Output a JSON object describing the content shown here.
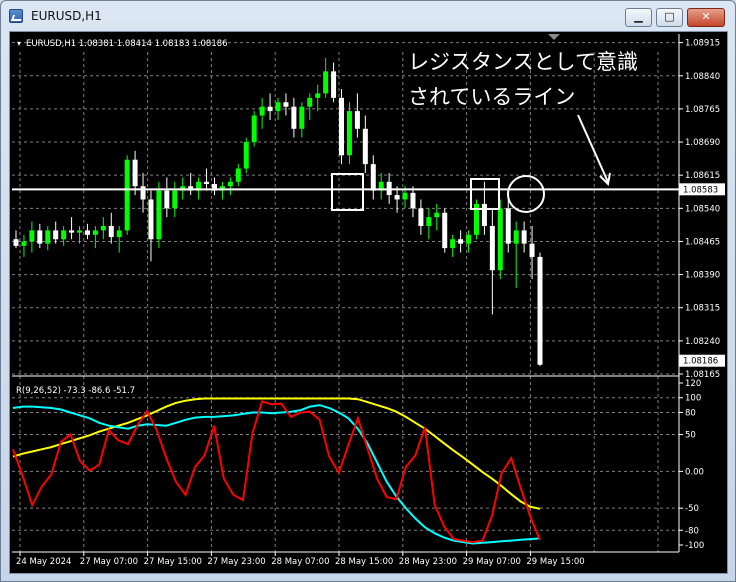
{
  "window": {
    "title": "EURUSD,H1",
    "buttons": {
      "minimize": "▁",
      "maximize": "□",
      "close": "✕"
    }
  },
  "chart_data": [
    {
      "type": "candlestick",
      "title": "EURUSD,H1",
      "header": "EURUSD,H1  1.08381 1.08414 1.08183 1.08186",
      "ylim": [
        1.08165,
        1.0893
      ],
      "y_ticks": [
        "1.08915",
        "1.08840",
        "1.08765",
        "1.08690",
        "1.08615",
        "1.08540",
        "1.08465",
        "1.08390",
        "1.08315",
        "1.08240",
        "1.08165"
      ],
      "x_ticks": [
        "24 May 2024",
        "27 May 07:00",
        "27 May 15:00",
        "27 May 23:00",
        "28 May 07:00",
        "28 May 15:00",
        "28 May 23:00",
        "29 May 07:00",
        "29 May 15:00"
      ],
      "last_price": "1.08186",
      "resistance_price": "1.08583",
      "resistance_value": 1.08583,
      "colors": {
        "bull": "#00ff00",
        "bear": "#ffffff",
        "grid": "#7f7f7f",
        "line": "#ffffff"
      },
      "annotation": {
        "text_line1": "レジスタンスとして意識",
        "text_line2": "されているライン"
      },
      "candles": [
        [
          1.0847,
          1.0849,
          1.0845,
          1.08455
        ],
        [
          1.08455,
          1.0848,
          1.0843,
          1.08465
        ],
        [
          1.08465,
          1.0851,
          1.0844,
          1.0849
        ],
        [
          1.0849,
          1.08505,
          1.0845,
          1.0846
        ],
        [
          1.0846,
          1.085,
          1.08445,
          1.0849
        ],
        [
          1.0849,
          1.0851,
          1.0846,
          1.0847
        ],
        [
          1.0847,
          1.085,
          1.08455,
          1.0849
        ],
        [
          1.0849,
          1.0852,
          1.0847,
          1.08485
        ],
        [
          1.08485,
          1.085,
          1.0846,
          1.0849
        ],
        [
          1.0849,
          1.08505,
          1.0847,
          1.0848
        ],
        [
          1.0848,
          1.085,
          1.0845,
          1.0849
        ],
        [
          1.0849,
          1.0852,
          1.0847,
          1.085
        ],
        [
          1.085,
          1.0853,
          1.0846,
          1.08475
        ],
        [
          1.08475,
          1.085,
          1.0844,
          1.0849
        ],
        [
          1.0849,
          1.0866,
          1.0848,
          1.0865
        ],
        [
          1.0865,
          1.0867,
          1.0857,
          1.0859
        ],
        [
          1.0859,
          1.0862,
          1.0853,
          1.0856
        ],
        [
          1.0856,
          1.0858,
          1.0842,
          1.0847
        ],
        [
          1.0847,
          1.086,
          1.0845,
          1.0858
        ],
        [
          1.0858,
          1.0861,
          1.0852,
          1.0854
        ],
        [
          1.0854,
          1.086,
          1.0852,
          1.0858
        ],
        [
          1.0858,
          1.0861,
          1.0856,
          1.0859
        ],
        [
          1.0859,
          1.0862,
          1.0857,
          1.0858
        ],
        [
          1.0858,
          1.0861,
          1.0856,
          1.086
        ],
        [
          1.086,
          1.0863,
          1.0858,
          1.08595
        ],
        [
          1.08595,
          1.0861,
          1.0857,
          1.0858
        ],
        [
          1.0858,
          1.086,
          1.0856,
          1.0859
        ],
        [
          1.0859,
          1.0861,
          1.0857,
          1.086
        ],
        [
          1.086,
          1.0864,
          1.0859,
          1.0863
        ],
        [
          1.0863,
          1.087,
          1.0862,
          1.0869
        ],
        [
          1.0869,
          1.0876,
          1.0868,
          1.0875
        ],
        [
          1.0875,
          1.0879,
          1.0872,
          1.0877
        ],
        [
          1.0877,
          1.088,
          1.0874,
          1.0876
        ],
        [
          1.0876,
          1.0879,
          1.0874,
          1.0878
        ],
        [
          1.0878,
          1.088,
          1.0875,
          1.0877
        ],
        [
          1.0877,
          1.0879,
          1.087,
          1.0872
        ],
        [
          1.0872,
          1.0878,
          1.087,
          1.0877
        ],
        [
          1.0877,
          1.088,
          1.0874,
          1.0879
        ],
        [
          1.0879,
          1.0882,
          1.0876,
          1.088
        ],
        [
          1.088,
          1.0888,
          1.0879,
          1.0885
        ],
        [
          1.0885,
          1.0887,
          1.0878,
          1.0879
        ],
        [
          1.0879,
          1.0881,
          1.0864,
          1.0866
        ],
        [
          1.0866,
          1.0878,
          1.0864,
          1.0876
        ],
        [
          1.0876,
          1.088,
          1.087,
          1.0872
        ],
        [
          1.0872,
          1.0875,
          1.0862,
          1.0864
        ],
        [
          1.0864,
          1.0866,
          1.0856,
          1.0858
        ],
        [
          1.0858,
          1.0862,
          1.0856,
          1.086
        ],
        [
          1.086,
          1.0862,
          1.0855,
          1.0857
        ],
        [
          1.0857,
          1.0859,
          1.0853,
          1.0856
        ],
        [
          1.0856,
          1.0859,
          1.0854,
          1.08575
        ],
        [
          1.08575,
          1.0859,
          1.0852,
          1.0854
        ],
        [
          1.0854,
          1.0856,
          1.0848,
          1.085
        ],
        [
          1.085,
          1.0854,
          1.0847,
          1.0852
        ],
        [
          1.0852,
          1.0855,
          1.0849,
          1.0853
        ],
        [
          1.0853,
          1.0854,
          1.0844,
          1.0845
        ],
        [
          1.0845,
          1.0848,
          1.0843,
          1.0847
        ],
        [
          1.0847,
          1.0849,
          1.0844,
          1.0846
        ],
        [
          1.0846,
          1.0849,
          1.0844,
          1.0848
        ],
        [
          1.0848,
          1.0856,
          1.0847,
          1.0855
        ],
        [
          1.0855,
          1.086,
          1.0848,
          1.085
        ],
        [
          1.085,
          1.0854,
          1.083,
          1.084
        ],
        [
          1.084,
          1.0856,
          1.0838,
          1.0854
        ],
        [
          1.0854,
          1.0857,
          1.0844,
          1.0846
        ],
        [
          1.0846,
          1.0851,
          1.0836,
          1.0849
        ],
        [
          1.0849,
          1.0851,
          1.0844,
          1.0846
        ],
        [
          1.0846,
          1.085,
          1.0838,
          1.0843
        ],
        [
          1.0843,
          1.0844,
          1.08183,
          1.08186
        ]
      ]
    },
    {
      "type": "line",
      "title": "R(9,26,52) -73.3 -86.6 -51.7",
      "ylim": [
        -100,
        120
      ],
      "y_ticks": [
        "120",
        "100",
        "80",
        "50",
        "0.00",
        "-50",
        "-80",
        "-100"
      ],
      "y_tick_values": [
        120,
        100,
        80,
        50,
        0,
        -50,
        -80,
        -100
      ],
      "series": [
        {
          "name": "",
          "color": "#ffff00",
          "values": [
            20,
            24,
            27,
            30,
            33,
            37,
            41,
            45,
            49,
            54,
            58,
            62,
            66,
            71,
            76,
            82,
            88,
            93,
            96,
            98,
            99,
            99,
            99,
            99,
            99,
            99,
            99,
            99,
            99,
            99,
            99,
            99,
            99,
            99,
            99,
            99,
            98,
            94,
            90,
            86,
            81,
            74,
            66,
            58,
            48,
            38,
            28,
            19,
            9,
            -1,
            -10,
            -20,
            -31,
            -41,
            -48,
            -51
          ]
        },
        {
          "name": "",
          "color": "#00ffff",
          "values": [
            86,
            88,
            88,
            87,
            86,
            84,
            80,
            76,
            72,
            66,
            62,
            60,
            58,
            62,
            64,
            63,
            62,
            66,
            70,
            73,
            74,
            74,
            75,
            76,
            78,
            80,
            80,
            79,
            80,
            81,
            83,
            88,
            90,
            86,
            80,
            72,
            58,
            38,
            12,
            -14,
            -34,
            -50,
            -64,
            -76,
            -84,
            -90,
            -94,
            -96,
            -98,
            -97,
            -96,
            -95,
            -94,
            -93,
            -92,
            -91
          ]
        },
        {
          "name": "",
          "color": "#ff0000",
          "values": [
            30,
            -6,
            -46,
            -21,
            -4,
            40,
            50,
            14,
            1,
            9,
            56,
            42,
            37,
            63,
            82,
            56,
            18,
            -14,
            -32,
            6,
            22,
            62,
            -10,
            -32,
            -39,
            52,
            95,
            91,
            92,
            74,
            80,
            81,
            70,
            20,
            -2,
            36,
            72,
            31,
            -10,
            -35,
            -38,
            6,
            22,
            60,
            -45,
            -75,
            -92,
            -94,
            -96,
            -94,
            -60,
            -2,
            18,
            -23,
            -62,
            -93
          ]
        }
      ]
    }
  ]
}
